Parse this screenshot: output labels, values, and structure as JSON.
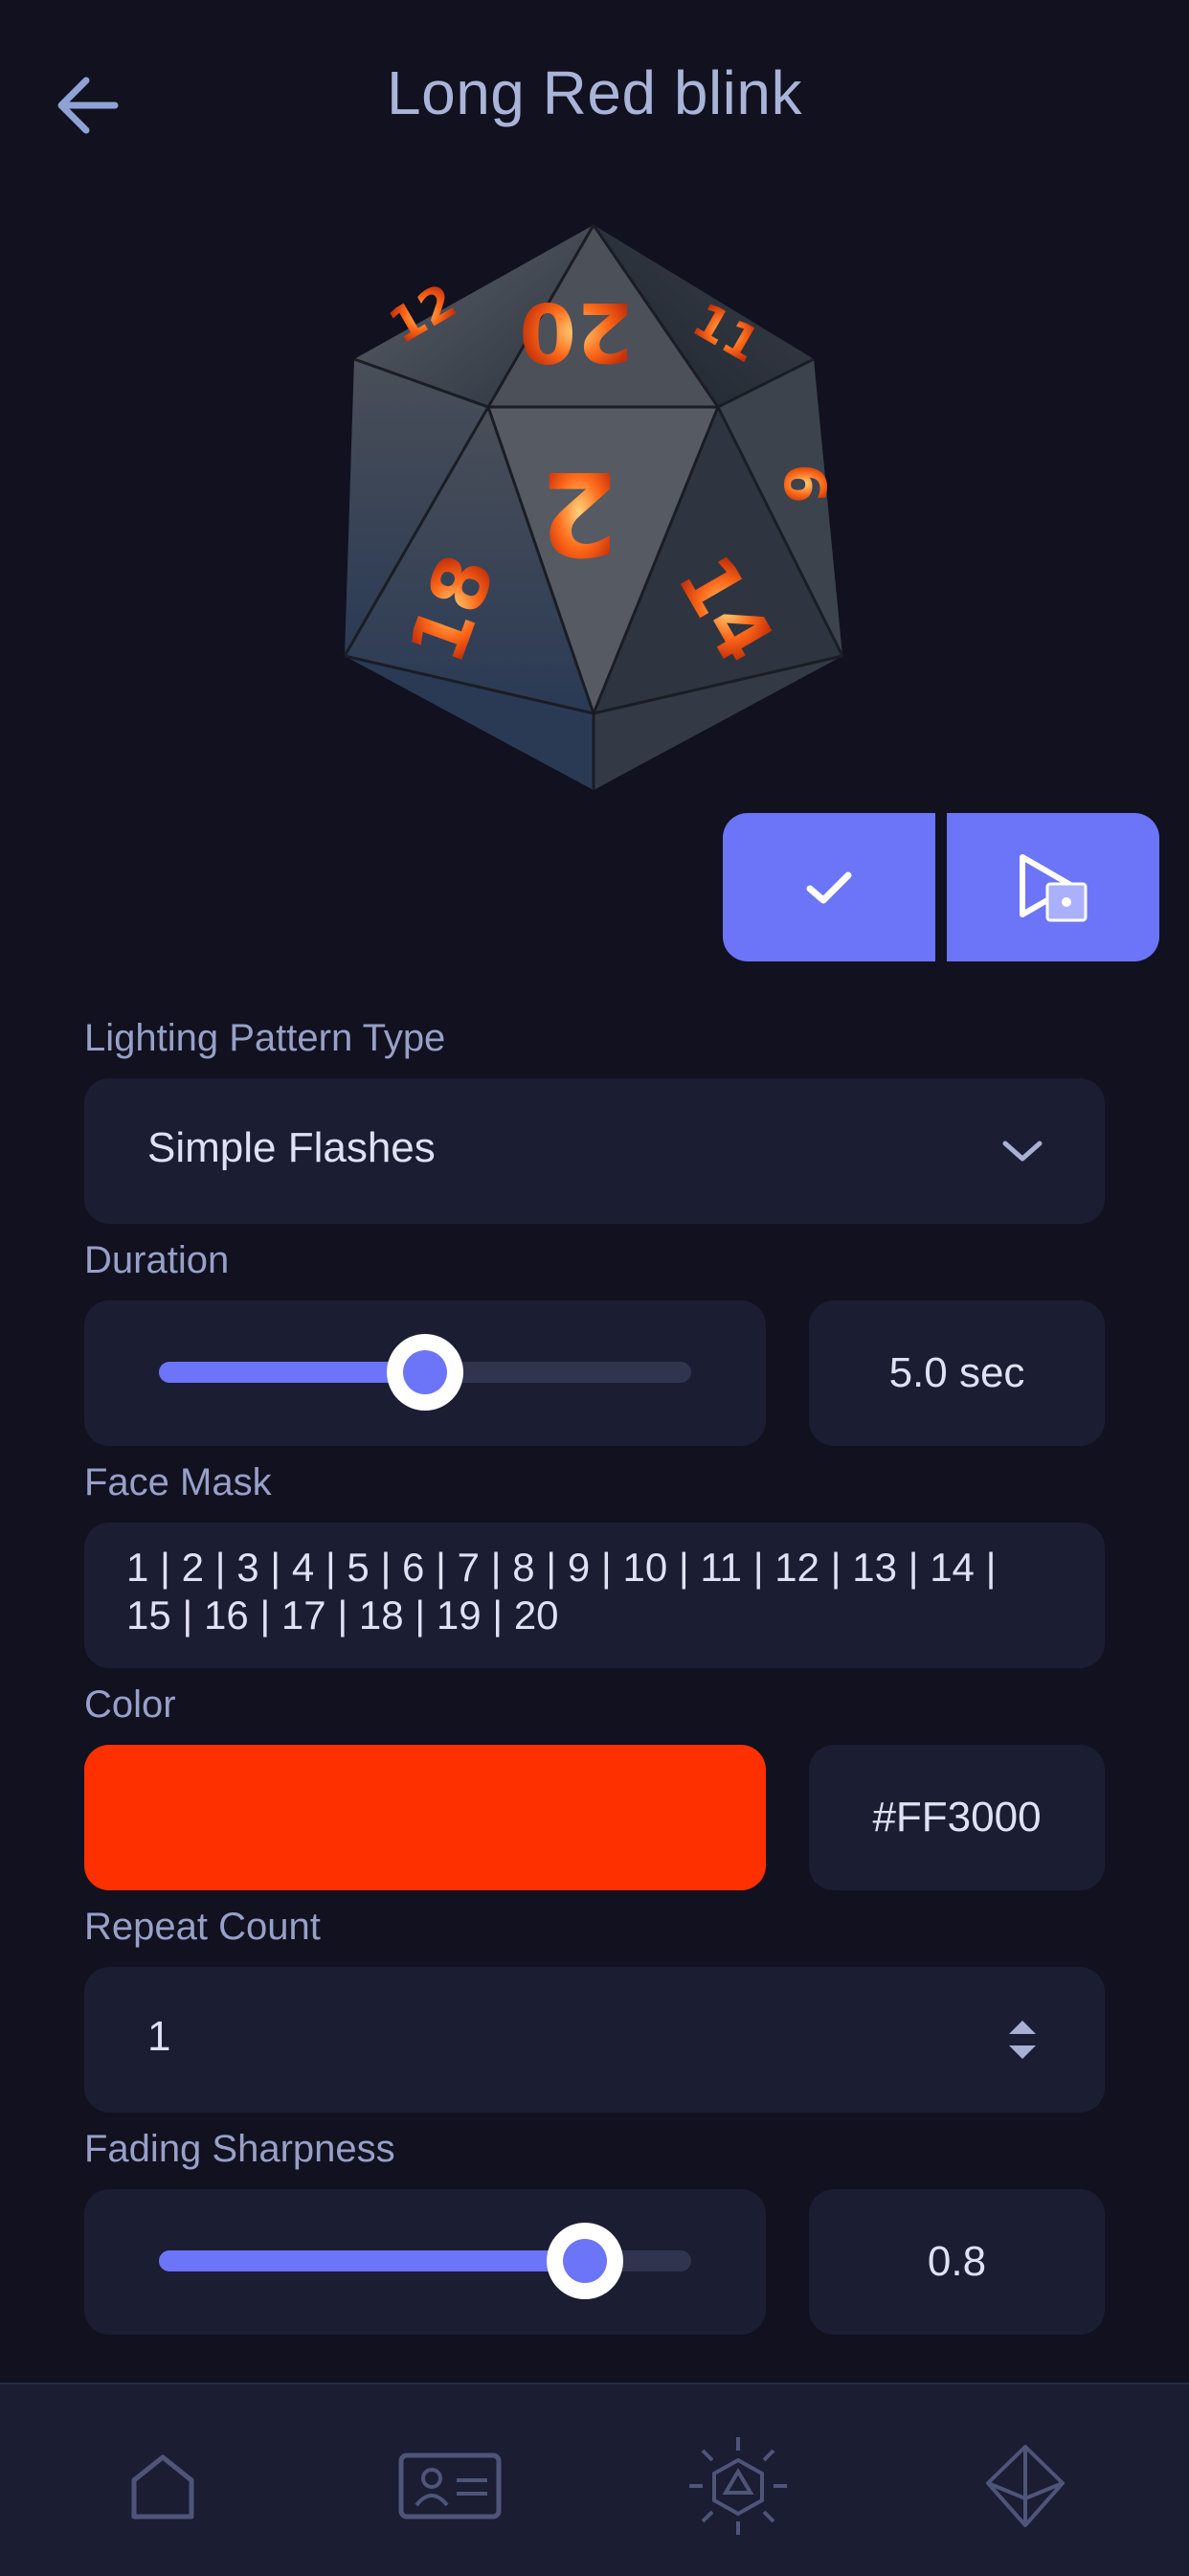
{
  "header": {
    "title": "Long Red blink"
  },
  "pattern": {
    "label": "Lighting Pattern Type",
    "value": "Simple Flashes"
  },
  "duration": {
    "label": "Duration",
    "value_text": "5.0 sec",
    "level": 0.5
  },
  "face_mask": {
    "label": "Face Mask",
    "line1": "1 | 2 | 3 | 4 | 5 | 6 | 7 | 8 | 9 | 10 | 11 | 12 | 13 | 14 |",
    "line2": "15 | 16 | 17 | 18 | 19 | 20"
  },
  "color": {
    "label": "Color",
    "hex": "#FF3000"
  },
  "repeat": {
    "label": "Repeat Count",
    "value": "1"
  },
  "fading": {
    "label": "Fading Sharpness",
    "value_text": "0.8",
    "level": 0.8
  },
  "die_faces": [
    "20",
    "2",
    "18",
    "14",
    "6",
    "12",
    "11"
  ],
  "icons": {
    "back": "arrow-left-icon",
    "confirm": "checkmark-icon",
    "preview": "play-on-die-icon",
    "dropdown": "chevron-down-icon",
    "stepper": "stepper-arrows-icon",
    "nav": [
      "home-icon",
      "profile-card-icon",
      "die-light-icon",
      "d20-icon"
    ]
  },
  "colors": {
    "background": "#11111f",
    "surface": "#1b1d33",
    "accent": "#6c74f8",
    "swatch": "#FF3000"
  }
}
